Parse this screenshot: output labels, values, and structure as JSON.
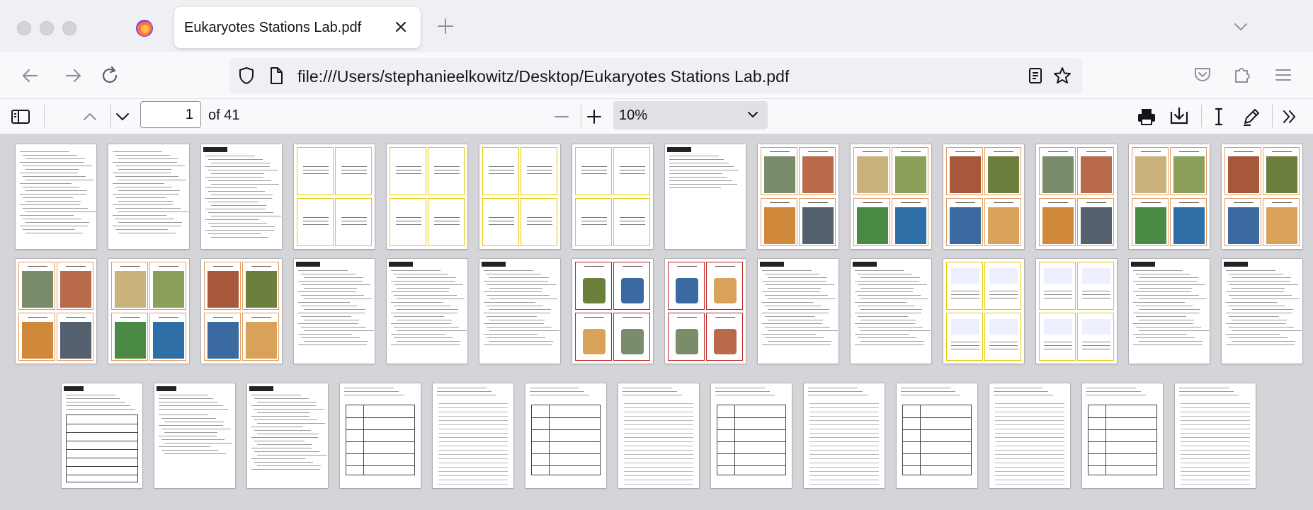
{
  "window": {
    "tab_title": "Eukaryotes Stations Lab.pdf"
  },
  "navbar": {
    "url": "file:///Users/stephanieelkowitz/Desktop/Eukaryotes Stations Lab.pdf"
  },
  "pdf_toolbar": {
    "current_page": "1",
    "page_count_label": "of 41",
    "zoom_level": "10%"
  },
  "colors": {
    "accent": "#0060df",
    "card_orange": "#e49a5f",
    "card_red": "#c02020",
    "card_yellow": "#e8c800"
  },
  "icons": {
    "back": "arrow-left-icon",
    "forward": "arrow-right-icon",
    "reload": "reload-icon",
    "shield": "shield-icon",
    "page": "page-icon",
    "reader": "reader-view-icon",
    "bookmark": "star-icon",
    "pocket": "pocket-icon",
    "extensions": "puzzle-icon",
    "menu": "hamburger-menu-icon"
  }
}
